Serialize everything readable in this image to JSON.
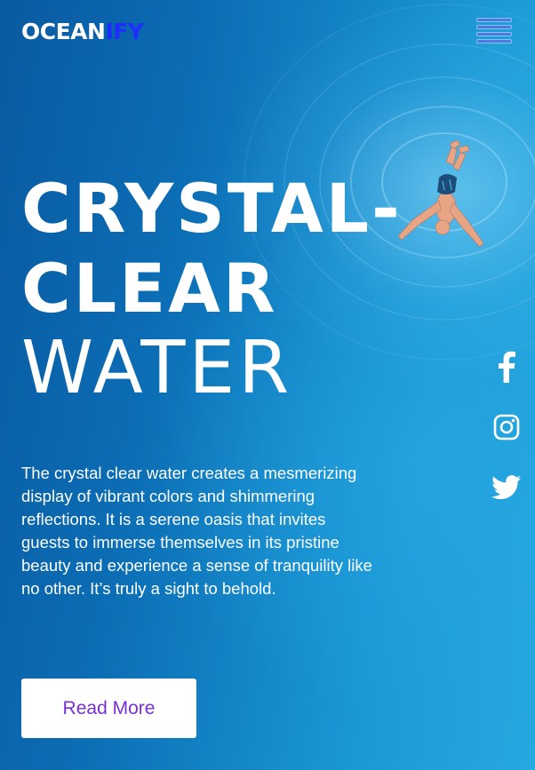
{
  "header": {
    "logo_part1": "OCEAN",
    "logo_part2": "IFY",
    "menu_icon": "hamburger-menu-icon"
  },
  "hero": {
    "title_line1": "CRYSTAL-",
    "title_line2": "CLEAR",
    "title_line3": "WATER",
    "description": "The crystal clear water creates a mesmerizing display of vibrant colors and shimmering reflections. It is a serene oasis that invites guests to immerse themselves in its pristine beauty and experience a sense of tranquility like no other. It’s truly a sight to behold.",
    "cta_label": "Read More"
  },
  "social": [
    {
      "name": "facebook",
      "icon": "facebook-icon"
    },
    {
      "name": "instagram",
      "icon": "instagram-icon"
    },
    {
      "name": "twitter",
      "icon": "twitter-icon"
    }
  ],
  "colors": {
    "brand_accent": "#1d2cff",
    "button_text": "#7a2fd6",
    "background": "#0b6cb4"
  }
}
